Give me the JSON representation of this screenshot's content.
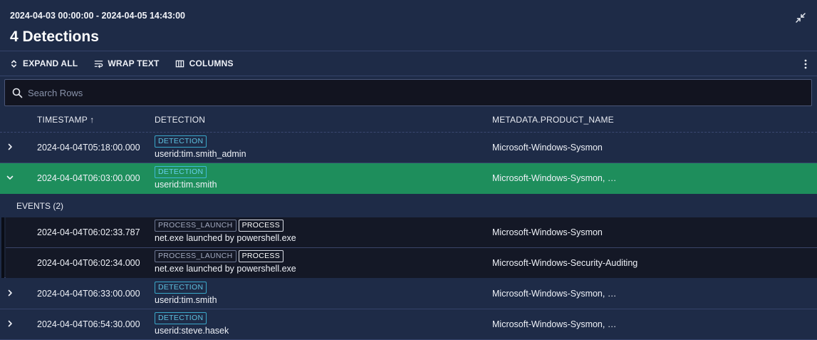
{
  "header": {
    "date_range": "2024-04-03 00:00:00 - 2024-04-05 14:43:00",
    "title": "4 Detections",
    "collapse_icon": "collapse-arrows-icon"
  },
  "toolbar": {
    "expand_all": "EXPAND ALL",
    "wrap_text": "WRAP TEXT",
    "columns": "COLUMNS"
  },
  "search": {
    "placeholder": "Search Rows",
    "value": ""
  },
  "columns": {
    "timestamp": "TIMESTAMP",
    "sort_indicator": "↑",
    "detection": "DETECTION",
    "product": "METADATA.PRODUCT_NAME"
  },
  "rows": [
    {
      "timestamp": "2024-04-04T05:18:00.000",
      "tag": "DETECTION",
      "detail": "userid:tim.smith_admin",
      "product": "Microsoft-Windows-Sysmon",
      "expanded": false
    },
    {
      "timestamp": "2024-04-04T06:03:00.000",
      "tag": "DETECTION",
      "detail": "userid:tim.smith",
      "product": "Microsoft-Windows-Sysmon, …",
      "expanded": true
    },
    {
      "timestamp": "2024-04-04T06:33:00.000",
      "tag": "DETECTION",
      "detail": "userid:tim.smith",
      "product": "Microsoft-Windows-Sysmon, …",
      "expanded": false
    },
    {
      "timestamp": "2024-04-04T06:54:30.000",
      "tag": "DETECTION",
      "detail": "userid:steve.hasek",
      "product": "Microsoft-Windows-Sysmon, …",
      "expanded": false
    }
  ],
  "events": {
    "label": "EVENTS (2)",
    "items": [
      {
        "timestamp": "2024-04-04T06:02:33.787",
        "tag1": "PROCESS_LAUNCH",
        "tag2": "PROCESS",
        "detail": "net.exe launched by powershell.exe",
        "product": "Microsoft-Windows-Sysmon"
      },
      {
        "timestamp": "2024-04-04T06:02:34.000",
        "tag1": "PROCESS_LAUNCH",
        "tag2": "PROCESS",
        "detail": "net.exe launched by powershell.exe",
        "product": "Microsoft-Windows-Security-Auditing"
      }
    ]
  },
  "colors": {
    "background": "#1e2b47",
    "selected_row": "#1e8e5c",
    "detection_tag": "#3aa7c9",
    "search_bg": "#121420"
  }
}
